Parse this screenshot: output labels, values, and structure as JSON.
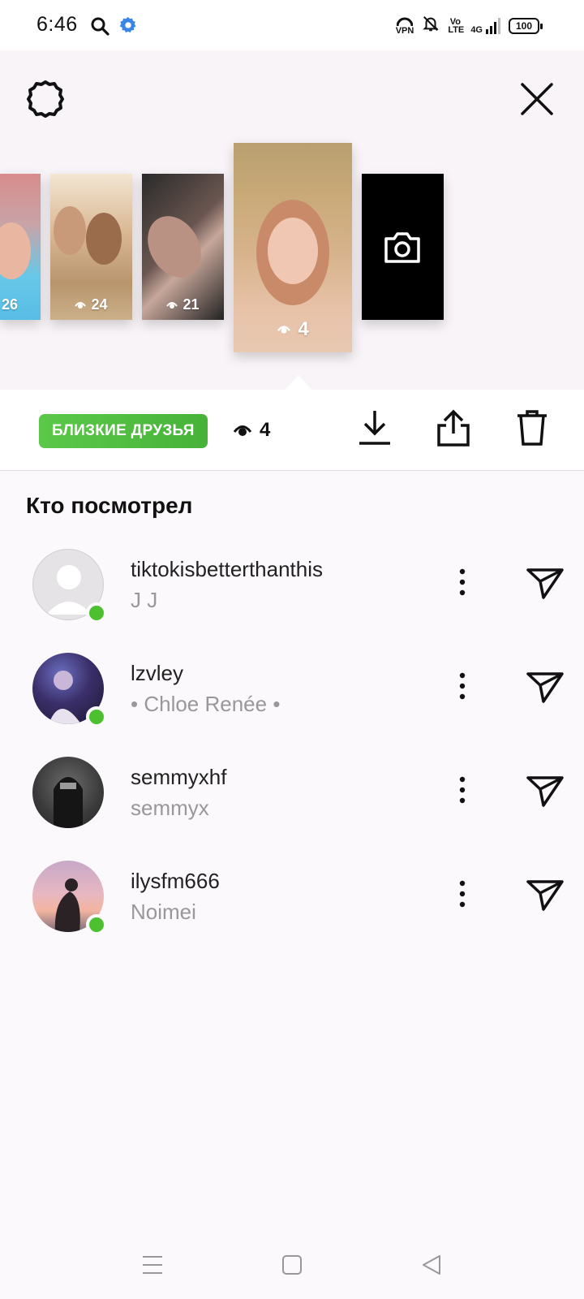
{
  "status_bar": {
    "time": "6:46",
    "vpn_label": "VPN",
    "volte_label": "Vo LTE",
    "network_label": "4G",
    "battery": "100"
  },
  "header": {
    "settings_icon": "gear-icon",
    "close_icon": "close-icon"
  },
  "stories": [
    {
      "views": "26"
    },
    {
      "views": "24"
    },
    {
      "views": "21"
    },
    {
      "views": "4",
      "selected": true
    },
    {
      "type": "camera",
      "icon": "camera-icon"
    }
  ],
  "action_bar": {
    "badge_label": "БЛИЗКИЕ ДРУЗЬЯ",
    "badge_color": "#4fbc3d",
    "view_count": "4",
    "download_icon": "download-icon",
    "share_icon": "share-icon",
    "delete_icon": "trash-icon"
  },
  "viewers": {
    "title": "Кто посмотрел",
    "items": [
      {
        "username": "tiktokisbetterthanthis",
        "name": "J J",
        "online": true
      },
      {
        "username": "lzvley",
        "name": "• Chloe Renée •",
        "online": true
      },
      {
        "username": "semmyxhf",
        "name": "semmyx",
        "online": false
      },
      {
        "username": "ilysfm666",
        "name": "Noimei",
        "online": true
      }
    ]
  },
  "nav_bar": {
    "menu_icon": "menu-icon",
    "home_icon": "square-icon",
    "back_icon": "back-triangle-icon"
  },
  "colors": {
    "online": "#4cc02f",
    "secondary_text": "#9a979a"
  }
}
